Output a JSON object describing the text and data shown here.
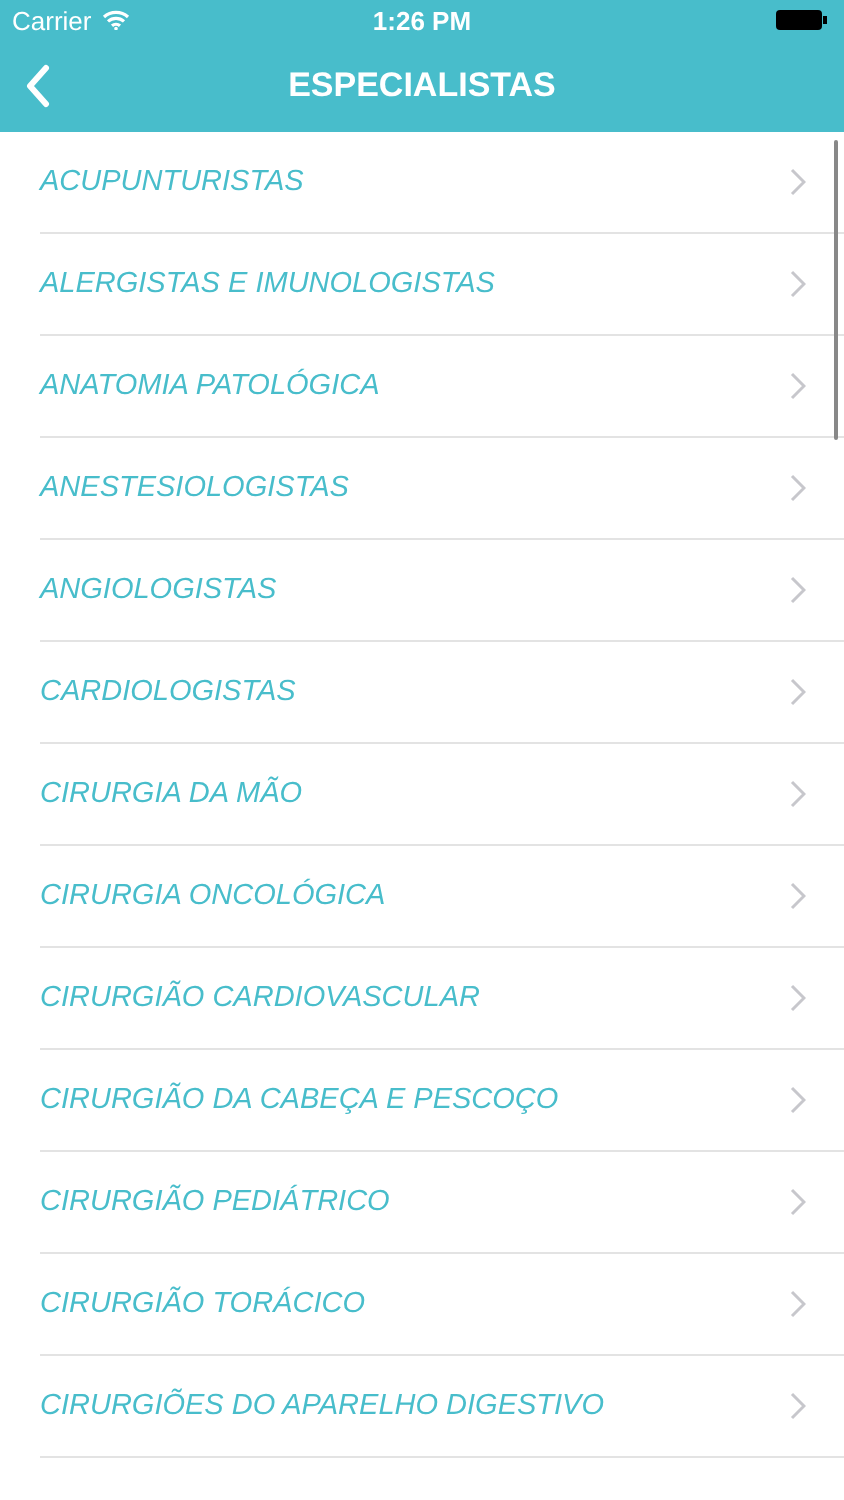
{
  "status_bar": {
    "carrier": "Carrier",
    "time": "1:26 PM"
  },
  "nav_bar": {
    "title": "ESPECIALISTAS"
  },
  "list": [
    {
      "label": "ACUPUNTURISTAS"
    },
    {
      "label": "ALERGISTAS E IMUNOLOGISTAS"
    },
    {
      "label": "ANATOMIA PATOLÓGICA"
    },
    {
      "label": "ANESTESIOLOGISTAS"
    },
    {
      "label": "ANGIOLOGISTAS"
    },
    {
      "label": "CARDIOLOGISTAS"
    },
    {
      "label": "CIRURGIA DA MÃO"
    },
    {
      "label": "CIRURGIA ONCOLÓGICA"
    },
    {
      "label": "CIRURGIÃO CARDIOVASCULAR"
    },
    {
      "label": "CIRURGIÃO DA CABEÇA E PESCOÇO"
    },
    {
      "label": "CIRURGIÃO PEDIÁTRICO"
    },
    {
      "label": "CIRURGIÃO TORÁCICO"
    },
    {
      "label": "CIRURGIÕES DO APARELHO DIGESTIVO"
    }
  ]
}
